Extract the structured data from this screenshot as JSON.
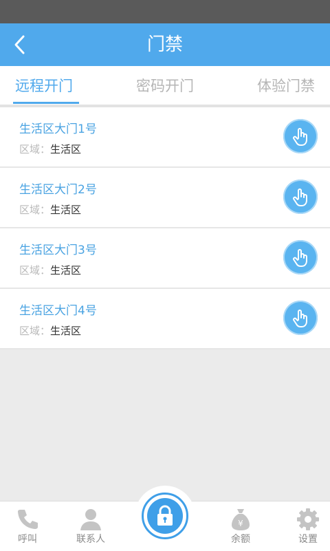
{
  "header": {
    "title": "门禁"
  },
  "tabs": [
    {
      "label": "远程开门",
      "active": true
    },
    {
      "label": "密码开门",
      "active": false
    },
    {
      "label": "体验门禁",
      "active": false
    }
  ],
  "doors": [
    {
      "name": "生活区大门1号",
      "area_label": "区域：",
      "area_value": "生活区"
    },
    {
      "name": "生活区大门2号",
      "area_label": "区域：",
      "area_value": "生活区"
    },
    {
      "name": "生活区大门3号",
      "area_label": "区域：",
      "area_value": "生活区"
    },
    {
      "name": "生活区大门4号",
      "area_label": "区域：",
      "area_value": "生活区"
    }
  ],
  "bottom_nav": [
    {
      "label": "呼叫",
      "icon": "phone-icon"
    },
    {
      "label": "联系人",
      "icon": "contact-icon"
    },
    {
      "label": "",
      "icon": "lock-icon"
    },
    {
      "label": "余额",
      "icon": "money-bag-icon"
    },
    {
      "label": "设置",
      "icon": "gear-icon"
    }
  ],
  "colors": {
    "accent": "#50a9ec",
    "status_bar": "#5a5a5a",
    "inactive_text": "#b5b5b5"
  }
}
